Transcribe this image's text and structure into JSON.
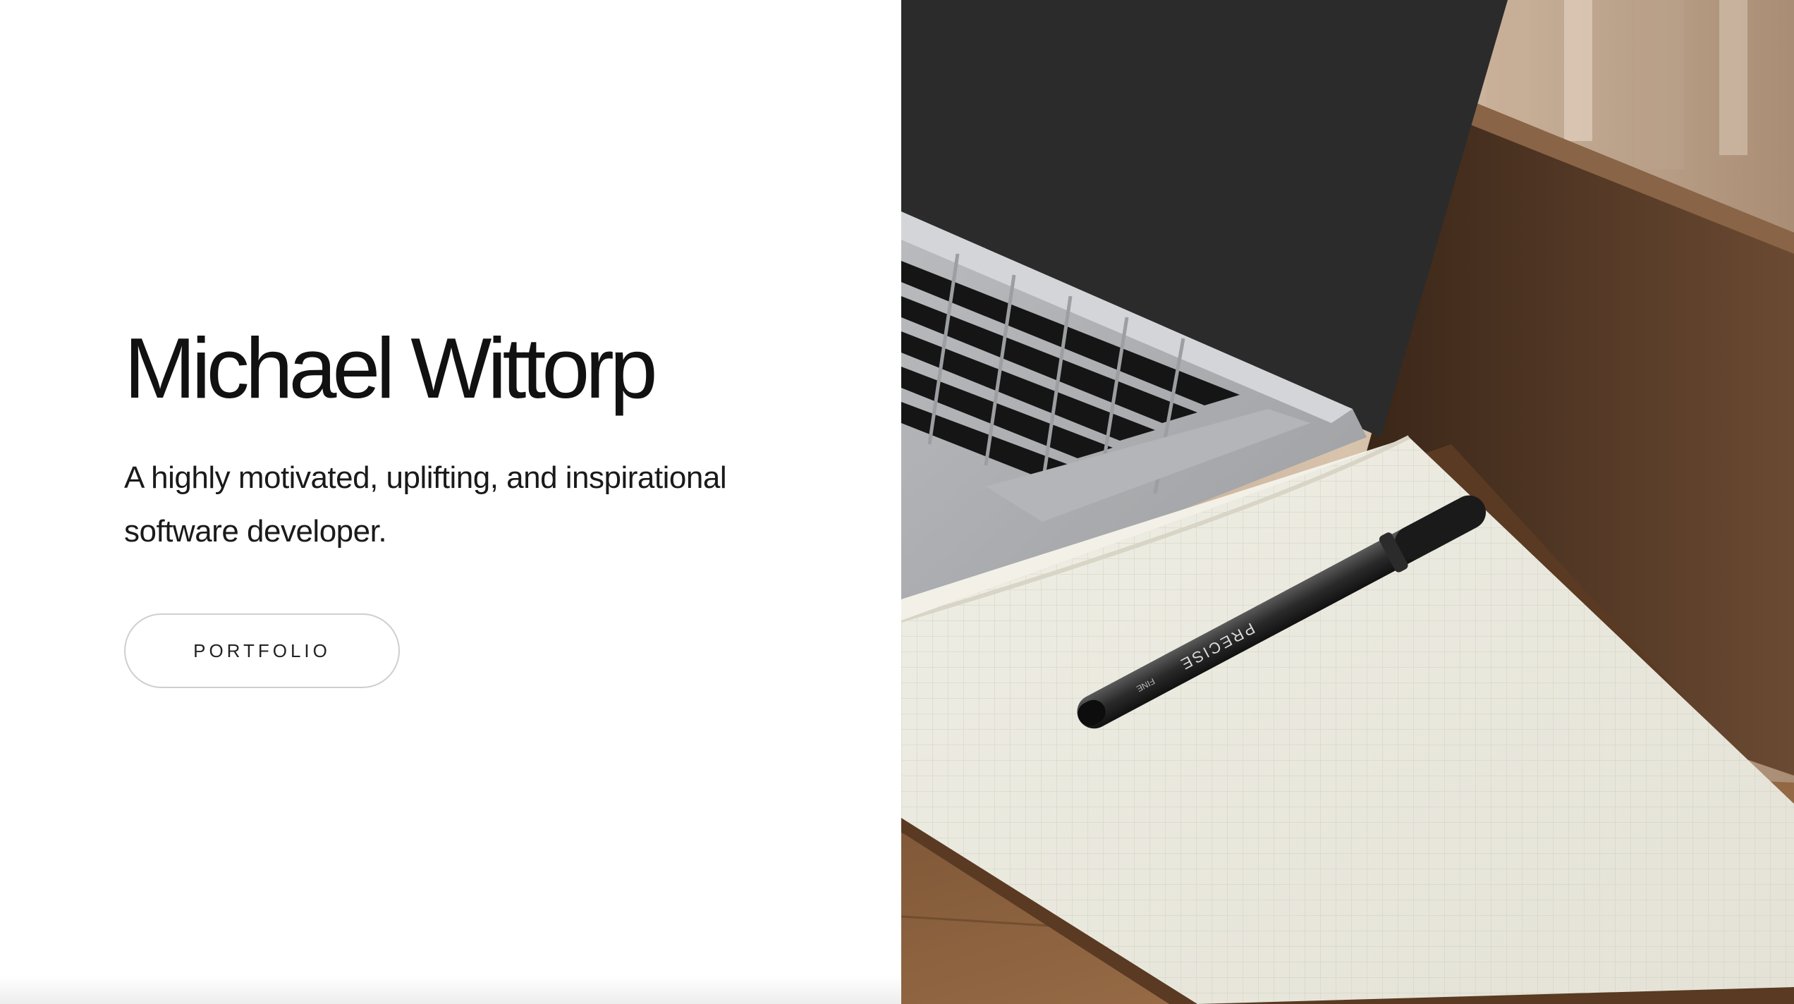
{
  "hero": {
    "name": "Michael Wittorp",
    "tagline_line1": "A highly motivated, uplifting, and inspirational",
    "tagline_line2": "software developer.",
    "cta_label": "PORTFOLIO"
  },
  "photo": {
    "pen_brand": "PRECISE",
    "pen_tip": "FINE"
  },
  "colors": {
    "text": "#111111",
    "button_border": "#cfcfcf",
    "background": "#ffffff"
  }
}
